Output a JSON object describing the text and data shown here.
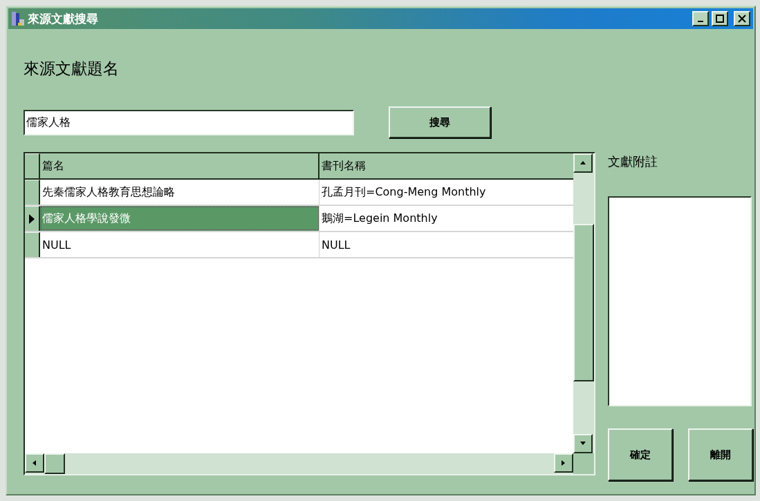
{
  "window": {
    "title": "來源文獻搜尋"
  },
  "heading": "來源文獻題名",
  "search": {
    "value": "儒家人格",
    "button": "搜尋"
  },
  "table": {
    "columns": [
      "篇名",
      "書刊名稱"
    ],
    "rows": [
      {
        "cells": [
          "先秦儒家人格教育思想論略",
          "孔孟月刊=Cong-Meng Monthly"
        ],
        "selected": false
      },
      {
        "cells": [
          "儒家人格學說發微",
          "鵝湖=Legein Monthly"
        ],
        "selected": true
      },
      {
        "cells": [
          "NULL",
          "NULL"
        ],
        "selected": false
      }
    ]
  },
  "notes": {
    "label": "文獻附註"
  },
  "buttons": [
    "確定",
    "離開"
  ]
}
